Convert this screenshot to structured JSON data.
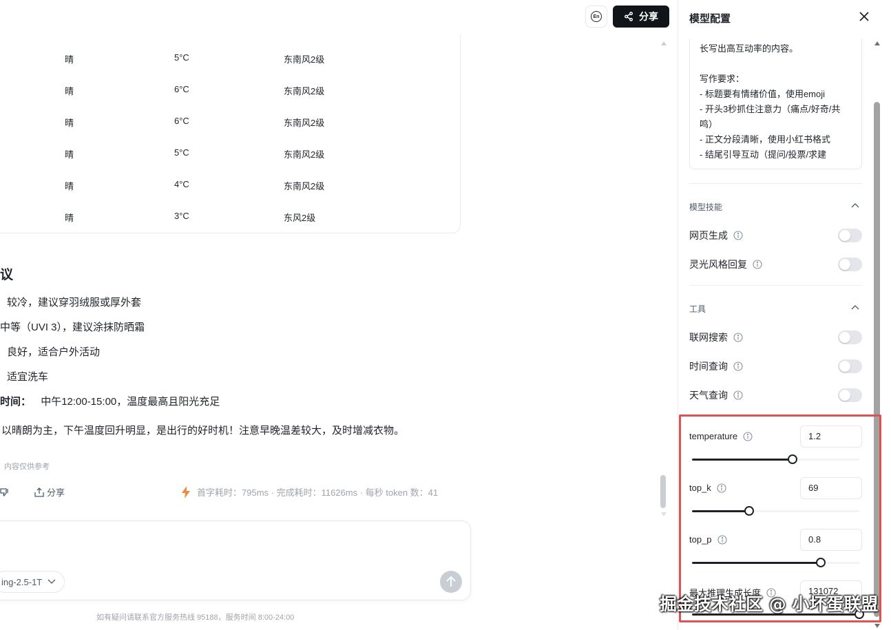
{
  "header": {
    "lang_label": "En",
    "share_label": "分享"
  },
  "weather_rows": [
    {
      "condition": "晴",
      "temp": "5°C",
      "wind": "东南风2级"
    },
    {
      "condition": "晴",
      "temp": "6°C",
      "wind": "东南风2级"
    },
    {
      "condition": "晴",
      "temp": "6°C",
      "wind": "东南风2级"
    },
    {
      "condition": "晴",
      "temp": "5°C",
      "wind": "东南风2级"
    },
    {
      "condition": "晴",
      "temp": "4°C",
      "wind": "东南风2级"
    },
    {
      "condition": "晴",
      "temp": "3°C",
      "wind": "东风2级"
    }
  ],
  "advice": {
    "title": "议",
    "lines": [
      "较冷，建议穿羽绒服或厚外套",
      "中等（UVI 3），建议涂抹防晒霜",
      "良好，适合户外活动",
      "适宜洗车"
    ],
    "best_time_label": "时间：",
    "best_time_value": "中午12:00-15:00，温度最高且阳光充足",
    "summary": "以晴朗为主，下午温度回升明显，是出行的好时机！注意早晚温差较大，及时增减衣物。"
  },
  "message_footer": {
    "disclaimer": "内容仅供参考",
    "share_label": "分享",
    "stats": "首字耗时：795ms · 完成耗时：11626ms · 每秒 token 数：41"
  },
  "composer": {
    "model_name": "ing-2.5-1T",
    "footer_note": "如有疑问请联系官方服务热线 95188，服务时间 8:00-24:00"
  },
  "panel": {
    "title": "模型配置",
    "prompt_lines": [
      "长写出高互动率的内容。",
      "",
      "写作要求：",
      "- 标题要有情绪价值，使用emoji",
      "- 开头3秒抓住注意力（痛点/好奇/共",
      "鸣）",
      "- 正文分段清晰，使用小红书格式",
      "- 结尾引导互动（提问/投票/求建"
    ],
    "skills_title": "模型技能",
    "skills": [
      {
        "label": "网页生成",
        "enabled": false
      },
      {
        "label": "灵光风格回复",
        "enabled": false
      }
    ],
    "tools_title": "工具",
    "tools": [
      {
        "label": "联网搜索",
        "enabled": false
      },
      {
        "label": "时间查询",
        "enabled": false
      },
      {
        "label": "天气查询",
        "enabled": false
      }
    ],
    "params": [
      {
        "label": "temperature",
        "value": "1.2",
        "fill_fraction": 0.6
      },
      {
        "label": "top_k",
        "value": "69",
        "fill_fraction": 0.34
      },
      {
        "label": "top_p",
        "value": "0.8",
        "fill_fraction": 0.77
      },
      {
        "label": "最大推理生成长度",
        "value": "131072",
        "fill_fraction": 1.0
      }
    ]
  },
  "watermark": "掘金技术社区 @ 小坏蛋联盟",
  "colors": {
    "highlight_border": "#e05252",
    "primary_dark": "#111418",
    "muted_text": "#a0a4ab"
  }
}
